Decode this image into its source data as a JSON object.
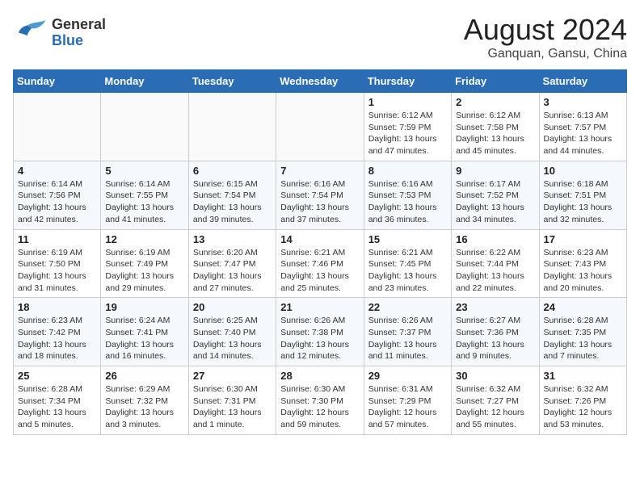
{
  "logo": {
    "general": "General",
    "blue": "Blue"
  },
  "title": "August 2024",
  "subtitle": "Ganquan, Gansu, China",
  "weekdays": [
    "Sunday",
    "Monday",
    "Tuesday",
    "Wednesday",
    "Thursday",
    "Friday",
    "Saturday"
  ],
  "weeks": [
    [
      {
        "day": "",
        "info": ""
      },
      {
        "day": "",
        "info": ""
      },
      {
        "day": "",
        "info": ""
      },
      {
        "day": "",
        "info": ""
      },
      {
        "day": "1",
        "info": "Sunrise: 6:12 AM\nSunset: 7:59 PM\nDaylight: 13 hours and 47 minutes."
      },
      {
        "day": "2",
        "info": "Sunrise: 6:12 AM\nSunset: 7:58 PM\nDaylight: 13 hours and 45 minutes."
      },
      {
        "day": "3",
        "info": "Sunrise: 6:13 AM\nSunset: 7:57 PM\nDaylight: 13 hours and 44 minutes."
      }
    ],
    [
      {
        "day": "4",
        "info": "Sunrise: 6:14 AM\nSunset: 7:56 PM\nDaylight: 13 hours and 42 minutes."
      },
      {
        "day": "5",
        "info": "Sunrise: 6:14 AM\nSunset: 7:55 PM\nDaylight: 13 hours and 41 minutes."
      },
      {
        "day": "6",
        "info": "Sunrise: 6:15 AM\nSunset: 7:54 PM\nDaylight: 13 hours and 39 minutes."
      },
      {
        "day": "7",
        "info": "Sunrise: 6:16 AM\nSunset: 7:54 PM\nDaylight: 13 hours and 37 minutes."
      },
      {
        "day": "8",
        "info": "Sunrise: 6:16 AM\nSunset: 7:53 PM\nDaylight: 13 hours and 36 minutes."
      },
      {
        "day": "9",
        "info": "Sunrise: 6:17 AM\nSunset: 7:52 PM\nDaylight: 13 hours and 34 minutes."
      },
      {
        "day": "10",
        "info": "Sunrise: 6:18 AM\nSunset: 7:51 PM\nDaylight: 13 hours and 32 minutes."
      }
    ],
    [
      {
        "day": "11",
        "info": "Sunrise: 6:19 AM\nSunset: 7:50 PM\nDaylight: 13 hours and 31 minutes."
      },
      {
        "day": "12",
        "info": "Sunrise: 6:19 AM\nSunset: 7:49 PM\nDaylight: 13 hours and 29 minutes."
      },
      {
        "day": "13",
        "info": "Sunrise: 6:20 AM\nSunset: 7:47 PM\nDaylight: 13 hours and 27 minutes."
      },
      {
        "day": "14",
        "info": "Sunrise: 6:21 AM\nSunset: 7:46 PM\nDaylight: 13 hours and 25 minutes."
      },
      {
        "day": "15",
        "info": "Sunrise: 6:21 AM\nSunset: 7:45 PM\nDaylight: 13 hours and 23 minutes."
      },
      {
        "day": "16",
        "info": "Sunrise: 6:22 AM\nSunset: 7:44 PM\nDaylight: 13 hours and 22 minutes."
      },
      {
        "day": "17",
        "info": "Sunrise: 6:23 AM\nSunset: 7:43 PM\nDaylight: 13 hours and 20 minutes."
      }
    ],
    [
      {
        "day": "18",
        "info": "Sunrise: 6:23 AM\nSunset: 7:42 PM\nDaylight: 13 hours and 18 minutes."
      },
      {
        "day": "19",
        "info": "Sunrise: 6:24 AM\nSunset: 7:41 PM\nDaylight: 13 hours and 16 minutes."
      },
      {
        "day": "20",
        "info": "Sunrise: 6:25 AM\nSunset: 7:40 PM\nDaylight: 13 hours and 14 minutes."
      },
      {
        "day": "21",
        "info": "Sunrise: 6:26 AM\nSunset: 7:38 PM\nDaylight: 13 hours and 12 minutes."
      },
      {
        "day": "22",
        "info": "Sunrise: 6:26 AM\nSunset: 7:37 PM\nDaylight: 13 hours and 11 minutes."
      },
      {
        "day": "23",
        "info": "Sunrise: 6:27 AM\nSunset: 7:36 PM\nDaylight: 13 hours and 9 minutes."
      },
      {
        "day": "24",
        "info": "Sunrise: 6:28 AM\nSunset: 7:35 PM\nDaylight: 13 hours and 7 minutes."
      }
    ],
    [
      {
        "day": "25",
        "info": "Sunrise: 6:28 AM\nSunset: 7:34 PM\nDaylight: 13 hours and 5 minutes."
      },
      {
        "day": "26",
        "info": "Sunrise: 6:29 AM\nSunset: 7:32 PM\nDaylight: 13 hours and 3 minutes."
      },
      {
        "day": "27",
        "info": "Sunrise: 6:30 AM\nSunset: 7:31 PM\nDaylight: 13 hours and 1 minute."
      },
      {
        "day": "28",
        "info": "Sunrise: 6:30 AM\nSunset: 7:30 PM\nDaylight: 12 hours and 59 minutes."
      },
      {
        "day": "29",
        "info": "Sunrise: 6:31 AM\nSunset: 7:29 PM\nDaylight: 12 hours and 57 minutes."
      },
      {
        "day": "30",
        "info": "Sunrise: 6:32 AM\nSunset: 7:27 PM\nDaylight: 12 hours and 55 minutes."
      },
      {
        "day": "31",
        "info": "Sunrise: 6:32 AM\nSunset: 7:26 PM\nDaylight: 12 hours and 53 minutes."
      }
    ]
  ]
}
